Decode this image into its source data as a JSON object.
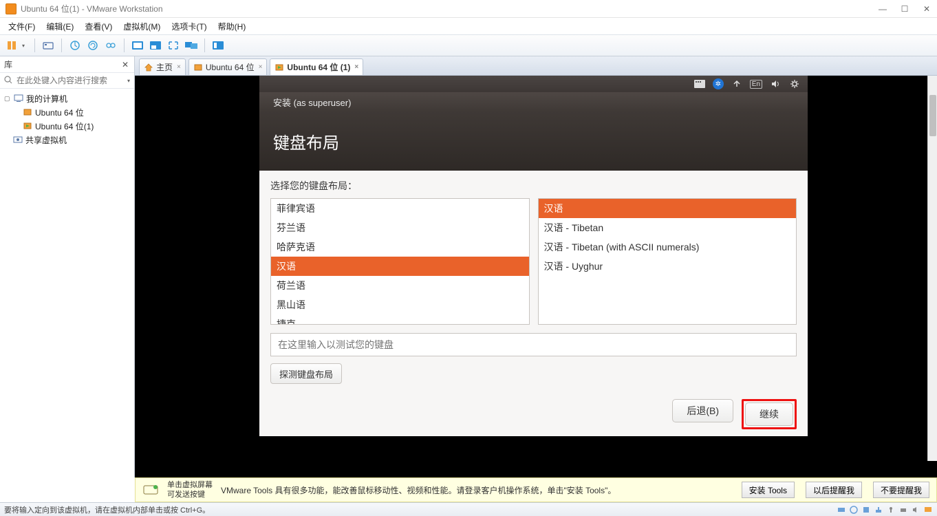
{
  "window": {
    "title": "Ubuntu 64 位(1) - VMware Workstation",
    "min": "—",
    "max": "☐",
    "close": "✕"
  },
  "menu": {
    "file": "文件(F)",
    "edit": "编辑(E)",
    "view": "查看(V)",
    "vm": "虚拟机(M)",
    "tabs": "选项卡(T)",
    "help": "帮助(H)"
  },
  "sidebar": {
    "header": "库",
    "close": "✕",
    "search_placeholder": "在此处键入内容进行搜索",
    "tree": {
      "root": "我的计算机",
      "child1": "Ubuntu 64 位",
      "child2": "Ubuntu 64 位(1)",
      "shared": "共享虚拟机"
    }
  },
  "tabs": {
    "home": "主页",
    "vm1": "Ubuntu 64 位",
    "vm2": "Ubuntu 64 位 (1)",
    "x": "×"
  },
  "vm_topbar": {
    "en": "En"
  },
  "installer": {
    "title": "安装 (as superuser)",
    "heading": "键盘布局",
    "prompt": "选择您的键盘布局：",
    "left_items": [
      "菲律宾语",
      "芬兰语",
      "哈萨克语",
      "汉语",
      "荷兰语",
      "黑山语",
      "捷克"
    ],
    "left_selected_index": 3,
    "right_items": [
      "汉语",
      "汉语 - Tibetan",
      "汉语 - Tibetan (with ASCII numerals)",
      "汉语 - Uyghur"
    ],
    "right_selected_index": 0,
    "test_placeholder": "在这里输入以测试您的键盘",
    "detect": "探测键盘布局",
    "back": "后退(B)",
    "continue": "继续"
  },
  "hint": {
    "line1": "单击虚拟屏幕",
    "line2": "可发送按键",
    "msg": "VMware Tools 具有很多功能，能改善鼠标移动性、视频和性能。请登录客户机操作系统，单击\"安装 Tools\"。",
    "install": "安装 Tools",
    "later": "以后提醒我",
    "never": "不要提醒我"
  },
  "status": {
    "text": "要将输入定向到该虚拟机，请在虚拟机内部单击或按 Ctrl+G。"
  }
}
